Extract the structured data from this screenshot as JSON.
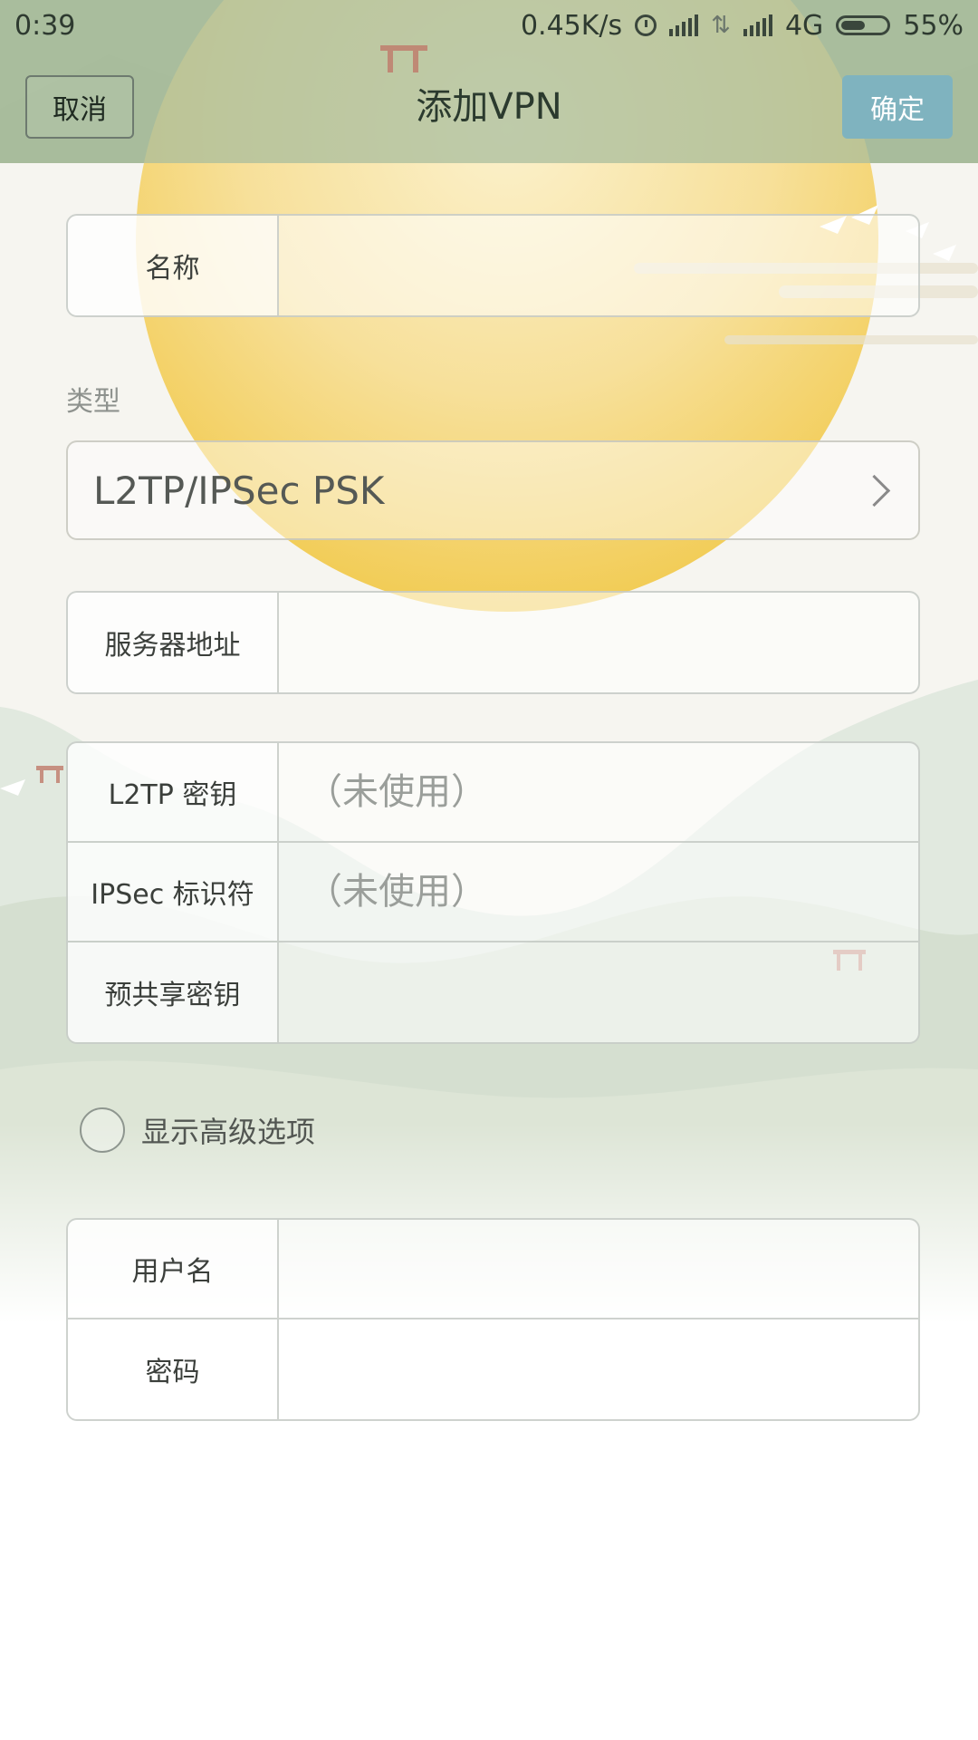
{
  "status_bar": {
    "time": "0:39",
    "speed": "0.45K/s",
    "network": "4G",
    "battery": "55%",
    "battery_level": 0.55
  },
  "header": {
    "cancel_label": "取消",
    "title": "添加VPN",
    "confirm_label": "确定"
  },
  "name_field": {
    "label": "名称",
    "value": ""
  },
  "type_section": {
    "label": "类型",
    "selected": "L2TP/IPSec PSK"
  },
  "server_field": {
    "label": "服务器地址",
    "value": ""
  },
  "secrets": [
    {
      "label": "L2TP 密钥",
      "placeholder": "（未使用）"
    },
    {
      "label": "IPSec 标识符",
      "placeholder": "（未使用）"
    },
    {
      "label": "预共享密钥",
      "placeholder": ""
    }
  ],
  "advanced": {
    "label": "显示高级选项",
    "checked": false
  },
  "credentials": {
    "username_label": "用户名",
    "password_label": "密码"
  },
  "colors": {
    "header_bg": "#a9bd9d",
    "confirm_bg": "#7fb3bf",
    "sun": "#f2cd56"
  }
}
